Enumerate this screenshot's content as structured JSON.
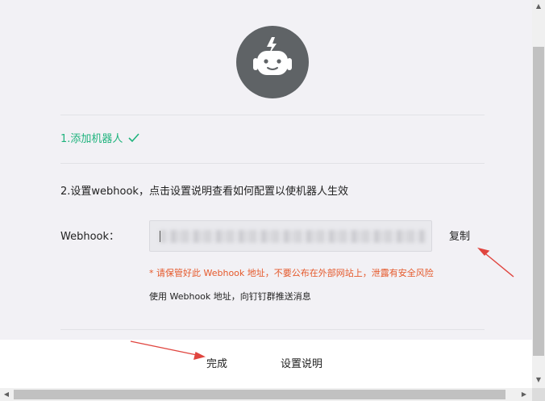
{
  "step1": {
    "label": "1.添加机器人"
  },
  "step2": {
    "label": "2.设置webhook，点击设置说明查看如何配置以使机器人生效"
  },
  "webhook": {
    "label": "Webhook：",
    "copy_label": "复制"
  },
  "warning": "* 请保管好此 Webhook 地址，不要公布在外部网站上，泄露有安全风险",
  "usage": "使用 Webhook 地址，向钉钉群推送消息",
  "footer": {
    "done_label": "完成",
    "help_label": "设置说明"
  },
  "colors": {
    "success": "#1fb37d",
    "warning": "#e5582a",
    "annotation_arrow": "#e0453f",
    "avatar_bg": "#5f6366"
  },
  "icons": {
    "avatar": "robot-icon",
    "step1_status": "checkmark-icon"
  }
}
